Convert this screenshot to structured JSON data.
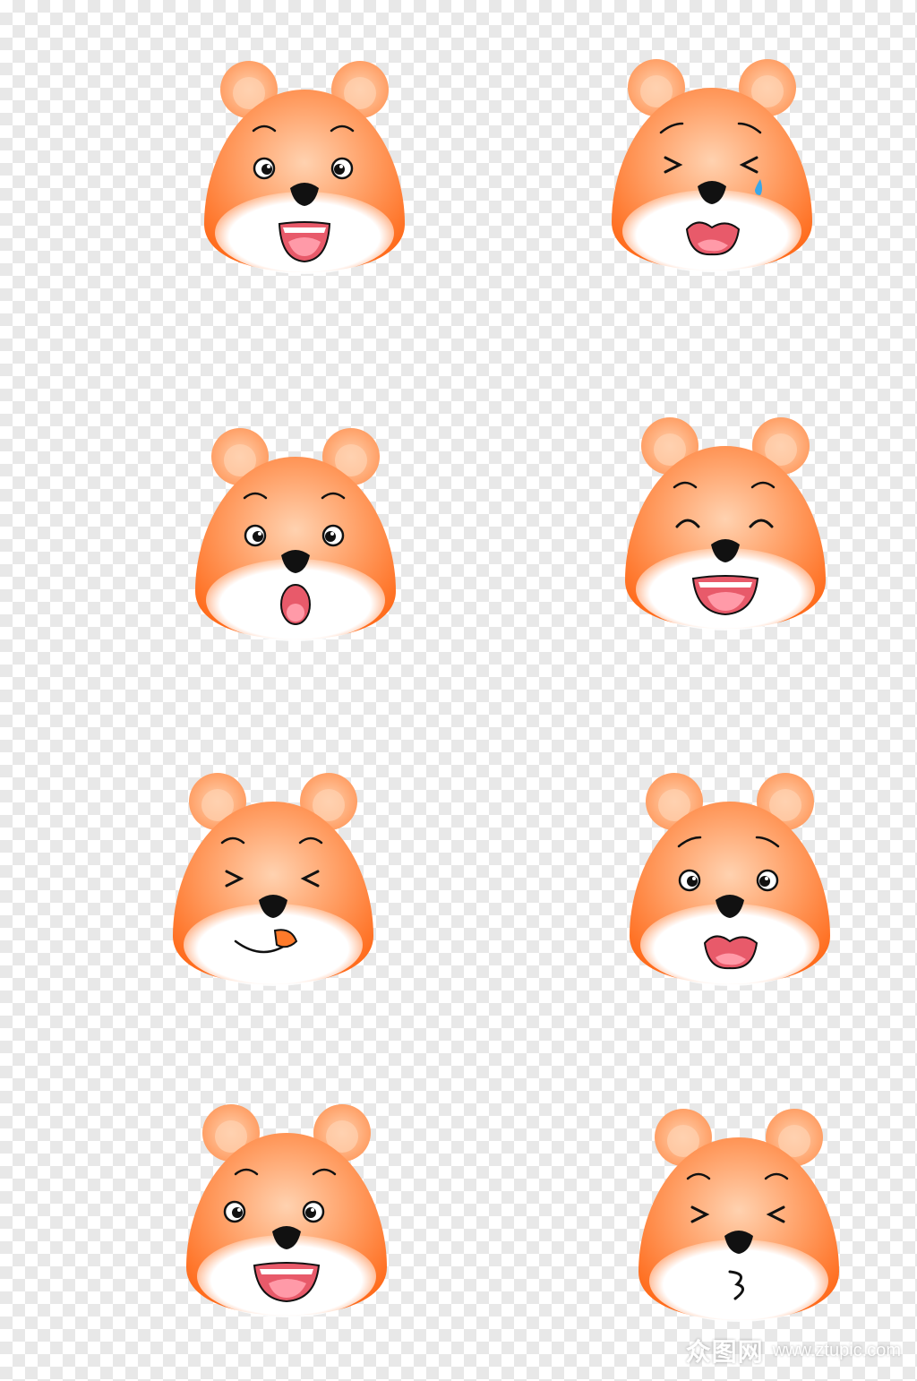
{
  "colors": {
    "fur_light": "#ffd2b0",
    "fur_mid": "#ff9a5e",
    "fur_dark": "#ff6a1a",
    "muzzle": "#ffffff",
    "nose": "#111111",
    "mouth": "#e85a6a",
    "tongue": "#ff9aa8",
    "tear": "#3aa7e8"
  },
  "bears": [
    {
      "expression": "happy-open-mouth"
    },
    {
      "expression": "crying-squint"
    },
    {
      "expression": "surprised"
    },
    {
      "expression": "laughing"
    },
    {
      "expression": "wink-lick"
    },
    {
      "expression": "worried"
    },
    {
      "expression": "shocked"
    },
    {
      "expression": "kiss-squint"
    }
  ],
  "watermark": {
    "logo": "众图网",
    "url": "www.ztupic.com"
  }
}
